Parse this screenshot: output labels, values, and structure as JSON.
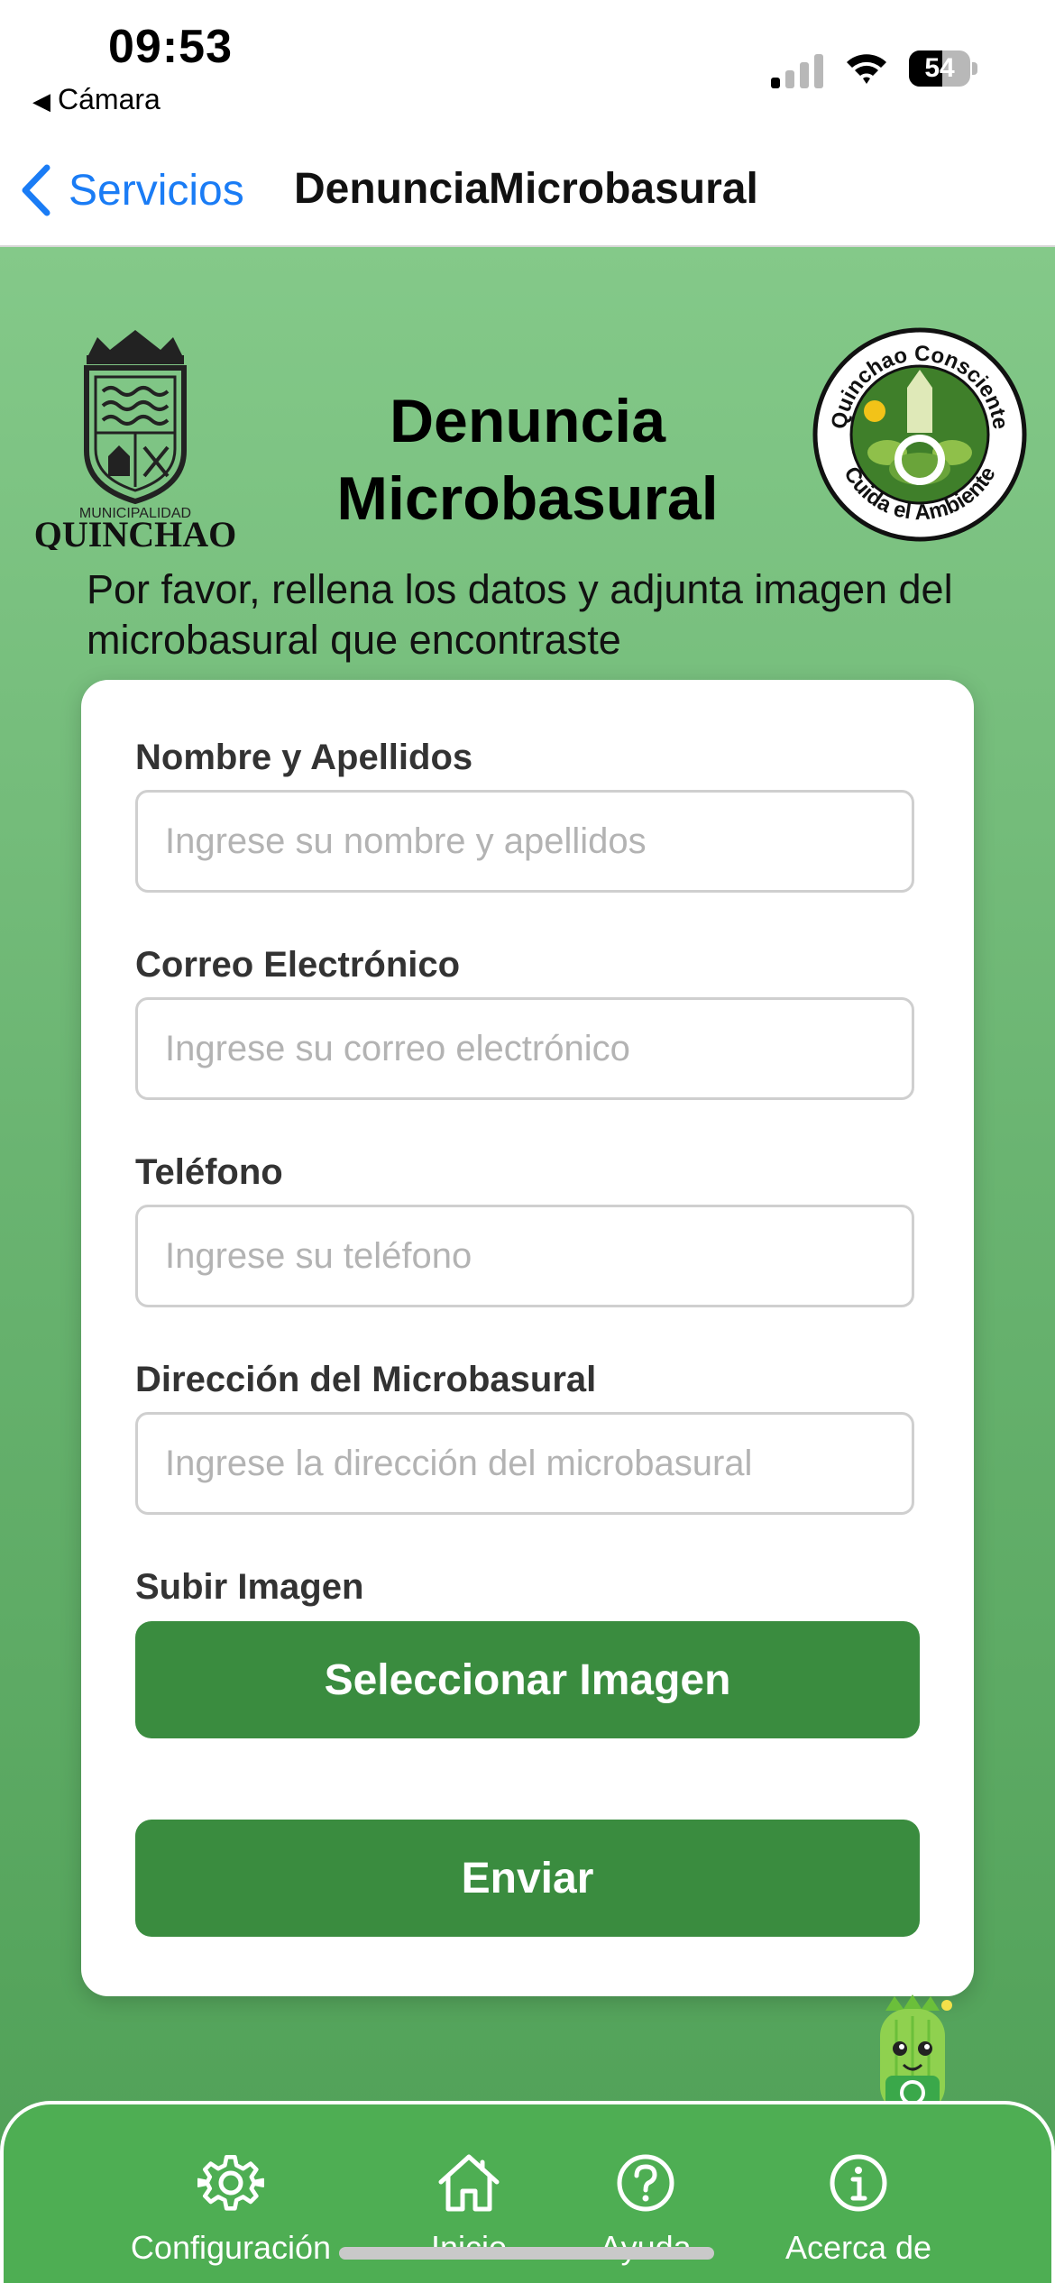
{
  "status": {
    "time": "09:53",
    "back_app": "Cámara",
    "battery": "54",
    "battery_level": 0.54
  },
  "nav": {
    "back_label": "Servicios",
    "title": "DenunciaMicrobasural"
  },
  "header": {
    "title_line1": "Denuncia",
    "title_line2": "Microbasural",
    "subtitle": "Por favor, rellena los datos y adjunta imagen del microbasural que encontraste",
    "left_logo": {
      "top_text": "MUNICIPALIDAD",
      "name": "QUINCHAO"
    },
    "right_logo": {
      "ring_top": "Quinchao Consciente",
      "ring_bottom": "Cuida el Ambiente"
    }
  },
  "form": {
    "name": {
      "label": "Nombre y Apellidos",
      "placeholder": "Ingrese su nombre y apellidos",
      "value": ""
    },
    "email": {
      "label": "Correo Electrónico",
      "placeholder": "Ingrese su correo electrónico",
      "value": ""
    },
    "phone": {
      "label": "Teléfono",
      "placeholder": "Ingrese su teléfono",
      "value": ""
    },
    "address": {
      "label": "Dirección del Microbasural",
      "placeholder": "Ingrese la dirección del microbasural",
      "value": ""
    },
    "image": {
      "label": "Subir Imagen",
      "button": "Seleccionar Imagen"
    },
    "submit": "Enviar"
  },
  "tabbar": {
    "items": [
      {
        "label": "Configuración",
        "icon": "gear-icon"
      },
      {
        "label": "Inicio",
        "icon": "home-icon"
      },
      {
        "label": "Ayuda",
        "icon": "help-icon"
      },
      {
        "label": "Acerca de",
        "icon": "info-icon"
      }
    ]
  },
  "colors": {
    "accent_green": "#3a8c3f",
    "tabbar_green": "#4eae53",
    "ios_blue": "#1a7cf5"
  }
}
